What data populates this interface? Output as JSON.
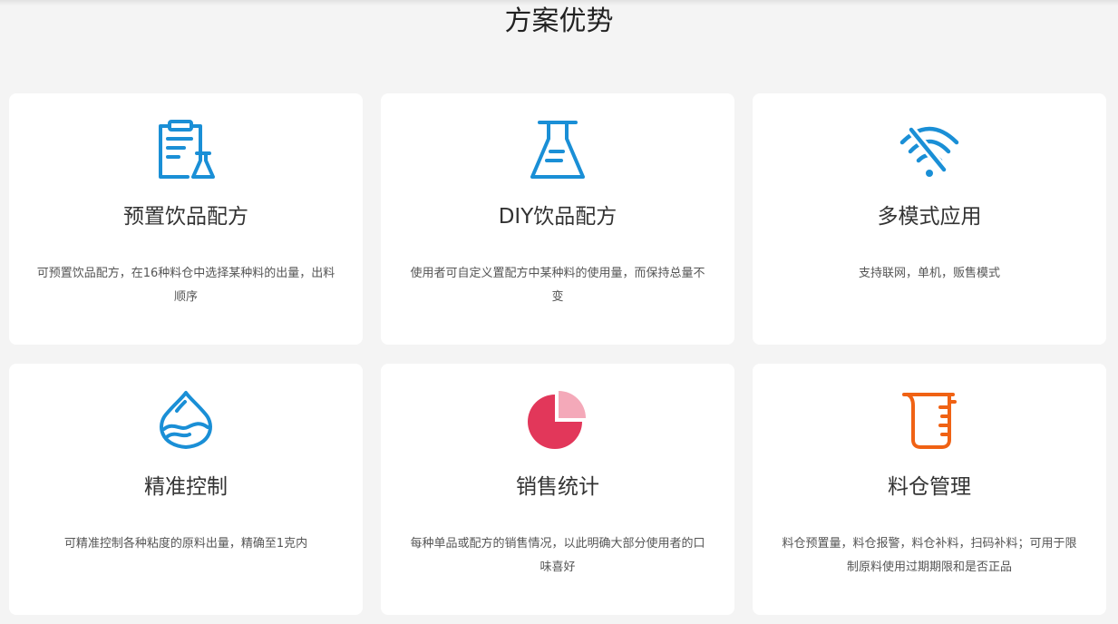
{
  "section": {
    "title": "方案优势"
  },
  "colors": {
    "blue": "#1a8fd6",
    "red": "#e2375a",
    "pink": "#f4a9b9",
    "orange": "#f06214"
  },
  "cards": [
    {
      "icon": "clipboard-flask-icon",
      "title": "预置饮品配方",
      "desc": "可预置饮品配方，在16种料仓中选择某种料的出量，出料顺序"
    },
    {
      "icon": "flask-icon",
      "title": "DIY饮品配方",
      "desc": "使用者可自定义置配方中某种料的使用量，而保持总量不变"
    },
    {
      "icon": "wifi-off-icon",
      "title": "多模式应用",
      "desc": "支持联网，单机，贩售模式"
    },
    {
      "icon": "water-drop-icon",
      "title": "精准控制",
      "desc": "可精准控制各种粘度的原料出量，精确至1克内"
    },
    {
      "icon": "pie-chart-icon",
      "title": "销售统计",
      "desc": "每种单品或配方的销售情况，以此明确大部分使用者的口味喜好"
    },
    {
      "icon": "measuring-cup-icon",
      "title": "料仓管理",
      "desc": "料仓预置量，料仓报警，料仓补料，扫码补料；可用于限制原料使用过期期限和是否正品"
    }
  ]
}
